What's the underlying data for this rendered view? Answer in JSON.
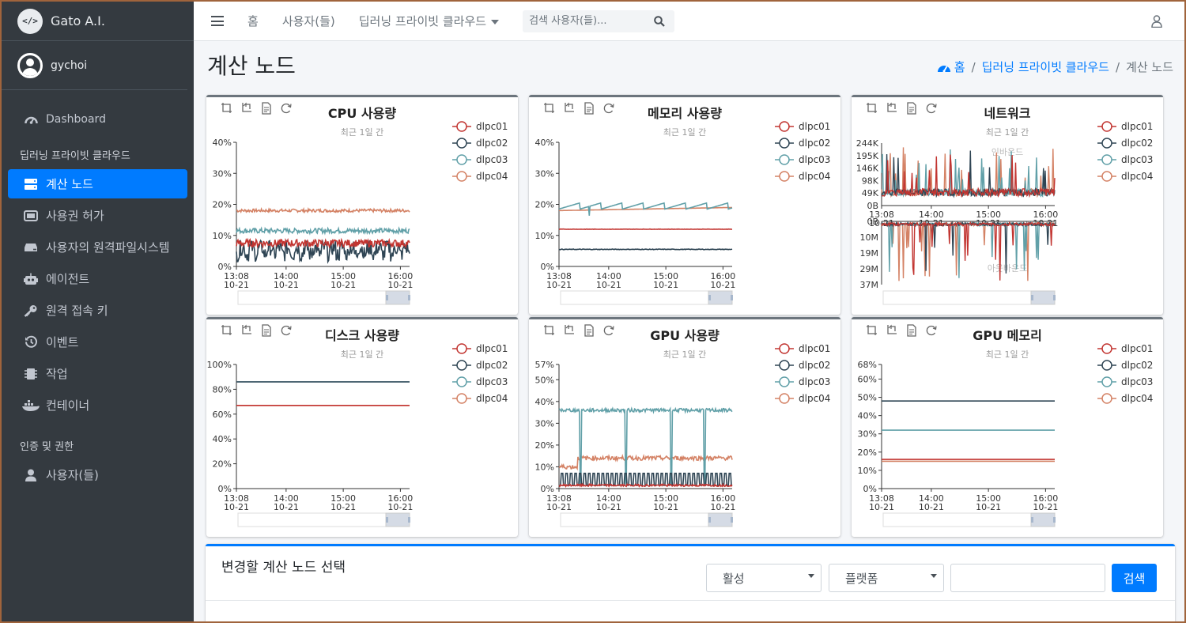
{
  "app": {
    "brand": "Gato A.I.",
    "brand_logo_glyph": "</>",
    "user": "gychoi"
  },
  "sidebar": {
    "dashboard": "Dashboard",
    "section_cloud": "딥러닝 프라이빗 클라우드",
    "items": [
      {
        "label": "계산 노드",
        "icon": "server-icon",
        "active": true
      },
      {
        "label": "사용권 허가",
        "icon": "license-icon",
        "active": false
      },
      {
        "label": "사용자의 원격파일시스템",
        "icon": "hdd-icon",
        "active": false
      },
      {
        "label": "에이전트",
        "icon": "robot-icon",
        "active": false
      },
      {
        "label": "원격 접속 키",
        "icon": "key-icon",
        "active": false
      },
      {
        "label": "이벤트",
        "icon": "history-icon",
        "active": false
      },
      {
        "label": "작업",
        "icon": "chip-icon",
        "active": false
      },
      {
        "label": "컨테이너",
        "icon": "docker-icon",
        "active": false
      }
    ],
    "section_auth": "인증 및 권한",
    "auth_items": [
      {
        "label": "사용자(들)",
        "icon": "user-icon"
      }
    ]
  },
  "topbar": {
    "home": "홈",
    "users": "사용자(들)",
    "cloud_menu": "딥러닝 프라이빗 클라우드",
    "search_placeholder": "검색 사용자(들)..."
  },
  "page": {
    "title": "계산 노드",
    "breadcrumb": [
      "홈",
      "딥러닝 프라이빗 클라우드",
      "계산 노드"
    ]
  },
  "colors": {
    "dlpc01": "#c23531",
    "dlpc02": "#2f4554",
    "dlpc03": "#61a0a8",
    "dlpc04": "#d48265",
    "accent": "#007bff",
    "sidebar_bg": "#343a40"
  },
  "chart_data": [
    {
      "type": "line",
      "title": "CPU 사용량",
      "subtitle": "최근 1일 간",
      "x_ticks": [
        {
          "t": "13:08",
          "d": "10-21"
        },
        {
          "t": "14:00",
          "d": "10-21"
        },
        {
          "t": "15:00",
          "d": "10-21"
        },
        {
          "t": "16:00",
          "d": "10-21"
        }
      ],
      "y_ticks": [
        "0%",
        "10%",
        "20%",
        "30%",
        "40%"
      ],
      "ylim": [
        0,
        40
      ],
      "series": [
        {
          "name": "dlpc01",
          "level": 7.5,
          "noise": 1.2
        },
        {
          "name": "dlpc02",
          "level": 6,
          "noise": 2.5
        },
        {
          "name": "dlpc03",
          "level": 11.5,
          "noise": 0.8
        },
        {
          "name": "dlpc04",
          "level": 18,
          "noise": 0.5
        }
      ]
    },
    {
      "type": "line",
      "title": "메모리 사용량",
      "subtitle": "최근 1일 간",
      "x_ticks": [
        {
          "t": "13:08",
          "d": "10-21"
        },
        {
          "t": "14:00",
          "d": "10-21"
        },
        {
          "t": "15:00",
          "d": "10-21"
        },
        {
          "t": "16:00",
          "d": "10-21"
        }
      ],
      "y_ticks": [
        "0%",
        "10%",
        "20%",
        "30%",
        "40%"
      ],
      "ylim": [
        0,
        40
      ],
      "series": [
        {
          "name": "dlpc01",
          "level": 12,
          "noise": 0.05
        },
        {
          "name": "dlpc02",
          "level": 5.5,
          "noise": 0.1
        },
        {
          "name": "dlpc03",
          "level": 19.5,
          "noise": 0.6
        },
        {
          "name": "dlpc04",
          "level": 18.5,
          "noise": 0.2
        }
      ]
    },
    {
      "type": "line",
      "title": "네트워크",
      "subtitle": "최근 1일 간",
      "inbound_label": "인바운드",
      "outbound_label": "아웃바운드",
      "x_ticks": [
        {
          "t": "13:08",
          "d": "10-21"
        },
        {
          "t": "14:00",
          "d": "10-21"
        },
        {
          "t": "15:00",
          "d": "10-21"
        },
        {
          "t": "16:00",
          "d": "10-21"
        }
      ],
      "y_ticks_top": [
        "0B",
        "49K",
        "98K",
        "146K",
        "195K",
        "244K"
      ],
      "y_ticks_bottom": [
        "0B",
        "10M",
        "19M",
        "29M",
        "37M"
      ],
      "series": [
        {
          "name": "dlpc01"
        },
        {
          "name": "dlpc02"
        },
        {
          "name": "dlpc03"
        },
        {
          "name": "dlpc04"
        }
      ]
    },
    {
      "type": "line",
      "title": "디스크 사용량",
      "subtitle": "최근 1일 간",
      "x_ticks": [
        {
          "t": "13:08",
          "d": "10-21"
        },
        {
          "t": "14:00",
          "d": "10-21"
        },
        {
          "t": "15:00",
          "d": "10-21"
        },
        {
          "t": "16:00",
          "d": "10-21"
        }
      ],
      "y_ticks": [
        "0%",
        "20%",
        "40%",
        "60%",
        "80%",
        "100%"
      ],
      "ylim": [
        0,
        100
      ],
      "series": [
        {
          "name": "dlpc01",
          "level": 67,
          "noise": 0
        },
        {
          "name": "dlpc02",
          "level": 86,
          "noise": 0
        },
        {
          "name": "dlpc03",
          "level": 86,
          "noise": 0
        },
        {
          "name": "dlpc04",
          "level": 67,
          "noise": 0
        }
      ]
    },
    {
      "type": "line",
      "title": "GPU 사용량",
      "subtitle": "최근 1일 간",
      "x_ticks": [
        {
          "t": "13:08",
          "d": "10-21"
        },
        {
          "t": "14:00",
          "d": "10-21"
        },
        {
          "t": "15:00",
          "d": "10-21"
        },
        {
          "t": "16:00",
          "d": "10-21"
        }
      ],
      "y_ticks": [
        "0%",
        "10%",
        "20%",
        "30%",
        "40%",
        "50%",
        "57%"
      ],
      "ylim": [
        0,
        57
      ],
      "series": [
        {
          "name": "dlpc01",
          "level": 1.5,
          "noise": 0.5
        },
        {
          "name": "dlpc02",
          "level": 5,
          "noise": 3
        },
        {
          "name": "dlpc03",
          "level": 36,
          "noise": 0.8
        },
        {
          "name": "dlpc04",
          "level": 14,
          "noise": 1
        }
      ]
    },
    {
      "type": "line",
      "title": "GPU 메모리",
      "subtitle": "최근 1일 간",
      "x_ticks": [
        {
          "t": "13:08",
          "d": "10-21"
        },
        {
          "t": "14:00",
          "d": "10-21"
        },
        {
          "t": "15:00",
          "d": "10-21"
        },
        {
          "t": "16:00",
          "d": "10-21"
        }
      ],
      "y_ticks": [
        "0%",
        "10%",
        "20%",
        "30%",
        "40%",
        "50%",
        "60%",
        "68%"
      ],
      "ylim": [
        0,
        68
      ],
      "series": [
        {
          "name": "dlpc01",
          "level": 16,
          "noise": 0
        },
        {
          "name": "dlpc02",
          "level": 48,
          "noise": 0
        },
        {
          "name": "dlpc03",
          "level": 32,
          "noise": 0
        },
        {
          "name": "dlpc04",
          "level": 15,
          "noise": 0
        }
      ]
    }
  ],
  "bottom": {
    "title": "변경할 계산 노드 선택",
    "status_select": "활성",
    "platform_select": "플랫폼",
    "search_button": "검색"
  }
}
